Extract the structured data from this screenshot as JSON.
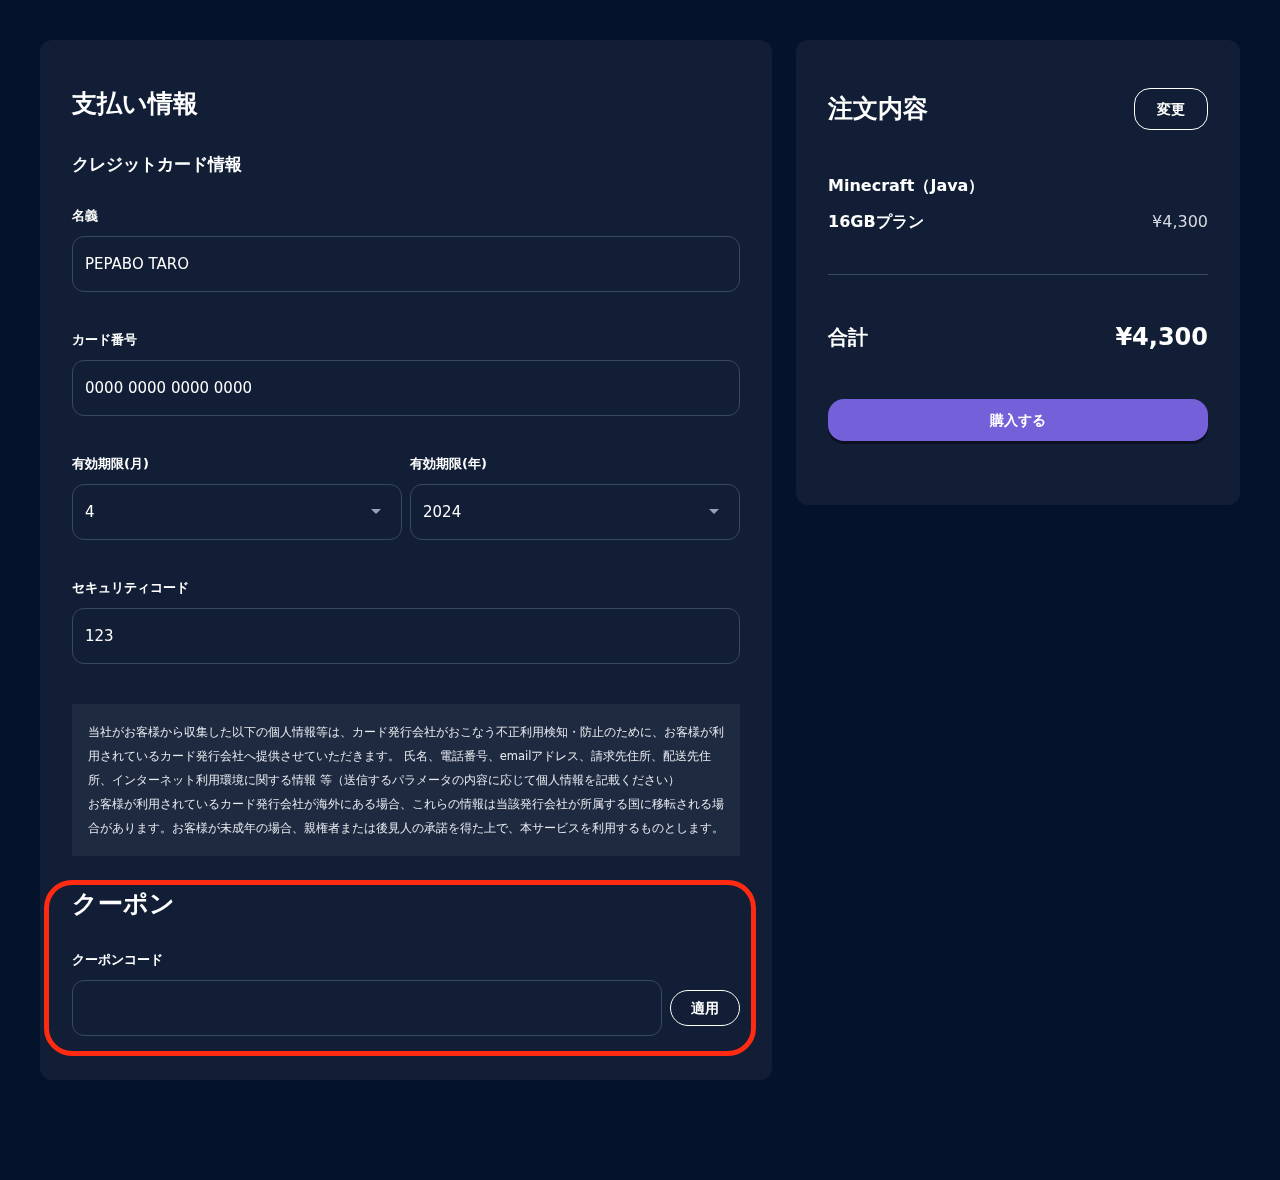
{
  "payment": {
    "title": "支払い情報",
    "subtitle": "クレジットカード情報",
    "fields": [
      {
        "kind": "text",
        "label": "名義",
        "value": "PEPABO TARO"
      },
      {
        "kind": "text",
        "label": "カード番号",
        "value": "0000 0000 0000 0000"
      }
    ],
    "expiry": [
      {
        "kind": "select",
        "label": "有効期限(月)",
        "value": "4"
      },
      {
        "kind": "select",
        "label": "有効期限(年)",
        "value": "2024"
      }
    ],
    "security": {
      "kind": "text",
      "label": "セキュリティコード",
      "value": "123"
    },
    "notice": [
      "当社がお客様から収集した以下の個人情報等は、カード発行会社がおこなう不正利用検知・防止のために、お客様が利用されているカード発行会社へ提供させていただきます。 氏名、電話番号、emailアドレス、請求先住所、配送先住所、インターネット利用環境に関する情報 等（送信するパラメータの内容に応じて個人情報を記載ください）",
      "お客様が利用されているカード発行会社が海外にある場合、これらの情報は当該発行会社が所属する国に移転される場合があります。お客様が未成年の場合、親権者または後見人の承諾を得た上で、本サービスを利用するものとします。"
    ]
  },
  "coupon": {
    "title": "クーポン",
    "highlighted": true,
    "label": "クーポンコード",
    "button": "適用"
  },
  "order": {
    "title": "注文内容",
    "change_button": "変更",
    "product": "Minecraft（Java）",
    "plan": "16GBプラン",
    "plan_price": "¥4,300",
    "total_label": "合計",
    "total": "¥4,300",
    "buy_button": "購入する"
  }
}
